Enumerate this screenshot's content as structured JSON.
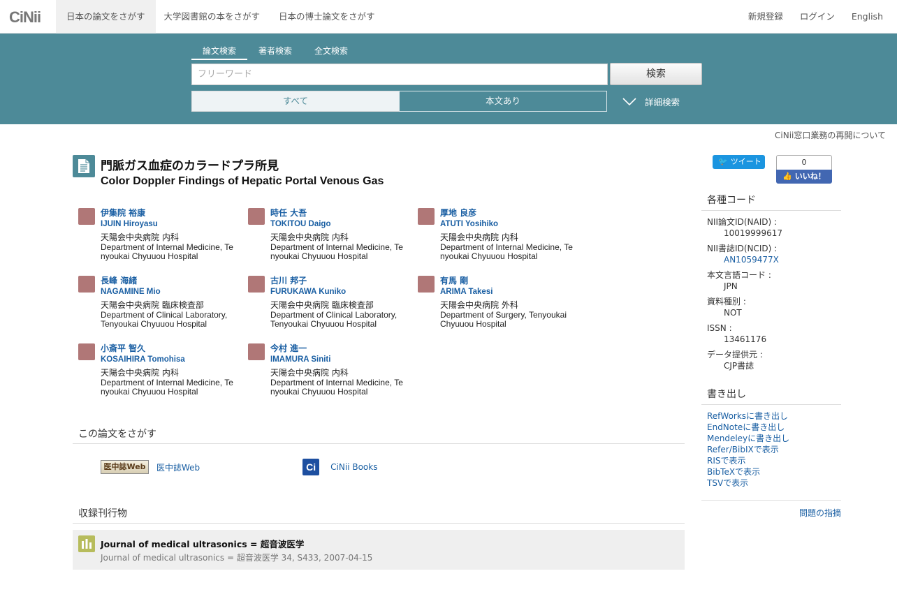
{
  "brand": {
    "logo": "CiNii"
  },
  "topnav": {
    "items": [
      "日本の論文をさがす",
      "大学図書館の本をさがす",
      "日本の博士論文をさがす"
    ]
  },
  "rightnav": {
    "register": "新規登録",
    "login": "ログイン",
    "language": "English"
  },
  "search": {
    "tabs": [
      "論文検索",
      "著者検索",
      "全文検索"
    ],
    "placeholder": "フリーワード",
    "button": "検索",
    "filter_all": "すべて",
    "filter_fulltext": "本文あり",
    "advanced": "詳細検索"
  },
  "notice": "CiNii窓口業務の再開について",
  "article": {
    "title_ja": "門脈ガス血症のカラードプラ所見",
    "title_en": "Color Doppler Findings of Hepatic Portal Venous Gas"
  },
  "authors": [
    {
      "name_ja": "伊集院 裕康",
      "name_en": "IJUIN Hiroyasu",
      "aff_ja": "天陽会中央病院 内科",
      "aff_en": "Department of Internal Medicine, Tenyoukai Chyuuou Hospital"
    },
    {
      "name_ja": "時任 大吾",
      "name_en": "TOKITOU Daigo",
      "aff_ja": "天陽会中央病院 内科",
      "aff_en": "Department of Internal Medicine, Tenyoukai Chyuuou Hospital"
    },
    {
      "name_ja": "厚地 良彦",
      "name_en": "ATUTI Yosihiko",
      "aff_ja": "天陽会中央病院 内科",
      "aff_en": "Department of Internal Medicine, Tenyoukai Chyuuou Hospital"
    },
    {
      "name_ja": "長峰 海緒",
      "name_en": "NAGAMINE Mio",
      "aff_ja": "天陽会中央病院 臨床検査部",
      "aff_en": "Department of Clinical Laboratory, Tenyoukai Chyuuou Hospital"
    },
    {
      "name_ja": "古川 邦子",
      "name_en": "FURUKAWA Kuniko",
      "aff_ja": "天陽会中央病院 臨床検査部",
      "aff_en": "Department of Clinical Laboratory, Tenyoukai Chyuuou Hospital"
    },
    {
      "name_ja": "有馬 剛",
      "name_en": "ARIMA Takesi",
      "aff_ja": "天陽会中央病院 外科",
      "aff_en": "Department of Surgery, Tenyoukai Chyuuou Hospital"
    },
    {
      "name_ja": "小斎平 智久",
      "name_en": "KOSAIHIRA Tomohisa",
      "aff_ja": "天陽会中央病院 内科",
      "aff_en": "Department of Internal Medicine, Tenyoukai Chyuuou Hospital"
    },
    {
      "name_ja": "今村 進一",
      "name_en": "IMAMURA Siniti",
      "aff_ja": "天陽会中央病院 内科",
      "aff_en": "Department of Internal Medicine, Tenyoukai Chyuuou Hospital"
    }
  ],
  "find_section": {
    "heading": "この論文をさがす",
    "ichushi_logo": "医中誌Web",
    "ichushi_link": "医中誌Web",
    "cinii_books_logo": "Ci",
    "cinii_books_link": "CiNii Books"
  },
  "journal_section": {
    "heading": "収録刊行物",
    "title": "Journal of medical ultrasonics = 超音波医学",
    "detail": "Journal of medical ultrasonics = 超音波医学 34, S433, 2007-04-15"
  },
  "social": {
    "tweet": "ツイート",
    "like_count": "0",
    "like": "いいね！"
  },
  "codes": {
    "heading": "各種コード",
    "items": [
      {
        "key": "NII論文ID(NAID) :",
        "value": "10019999617",
        "link": false
      },
      {
        "key": "NII書誌ID(NCID) :",
        "value": "AN1059477X",
        "link": true
      },
      {
        "key": "本文言語コード :",
        "value": "JPN",
        "link": false
      },
      {
        "key": "資料種別 :",
        "value": "NOT",
        "link": false
      },
      {
        "key": "ISSN :",
        "value": "13461176",
        "link": false
      },
      {
        "key": "データ提供元 :",
        "value": "CJP書誌",
        "link": false
      }
    ]
  },
  "exports": {
    "heading": "書き出し",
    "items": [
      "RefWorksに書き出し",
      "EndNoteに書き出し",
      "Mendeleyに書き出し",
      "Refer/BibIXで表示",
      "RISで表示",
      "BibTeXで表示",
      "TSVで表示"
    ]
  },
  "report": "問題の指摘",
  "colors": {
    "band": "#4d8a98",
    "link": "#1a5fa3",
    "author_avatar": "#b07777",
    "journal_icon": "#b7bc5c"
  }
}
